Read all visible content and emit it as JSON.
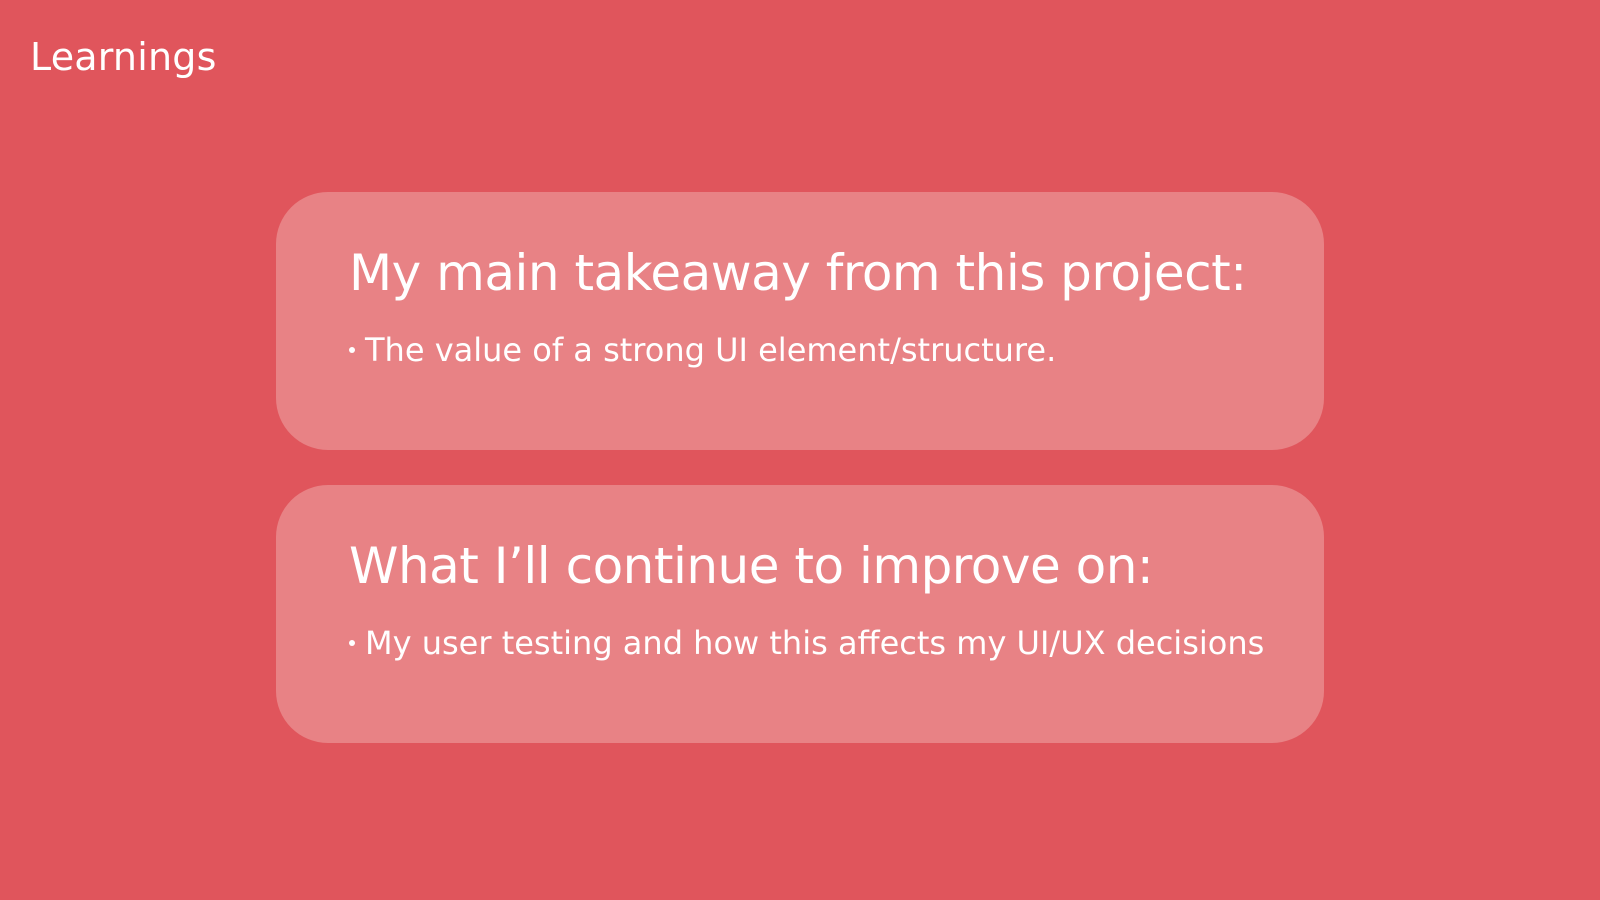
{
  "slide": {
    "title": "Learnings",
    "background_color": "#e0555c",
    "card_color": "#e88285",
    "text_color": "#ffffff"
  },
  "cards": [
    {
      "heading": "My main takeaway from this project:",
      "bullets": [
        "The value of a strong UI element/structure."
      ]
    },
    {
      "heading": "What I’ll continue to improve on:",
      "bullets": [
        "My user testing and how this affects my UI/UX decisions"
      ]
    }
  ]
}
